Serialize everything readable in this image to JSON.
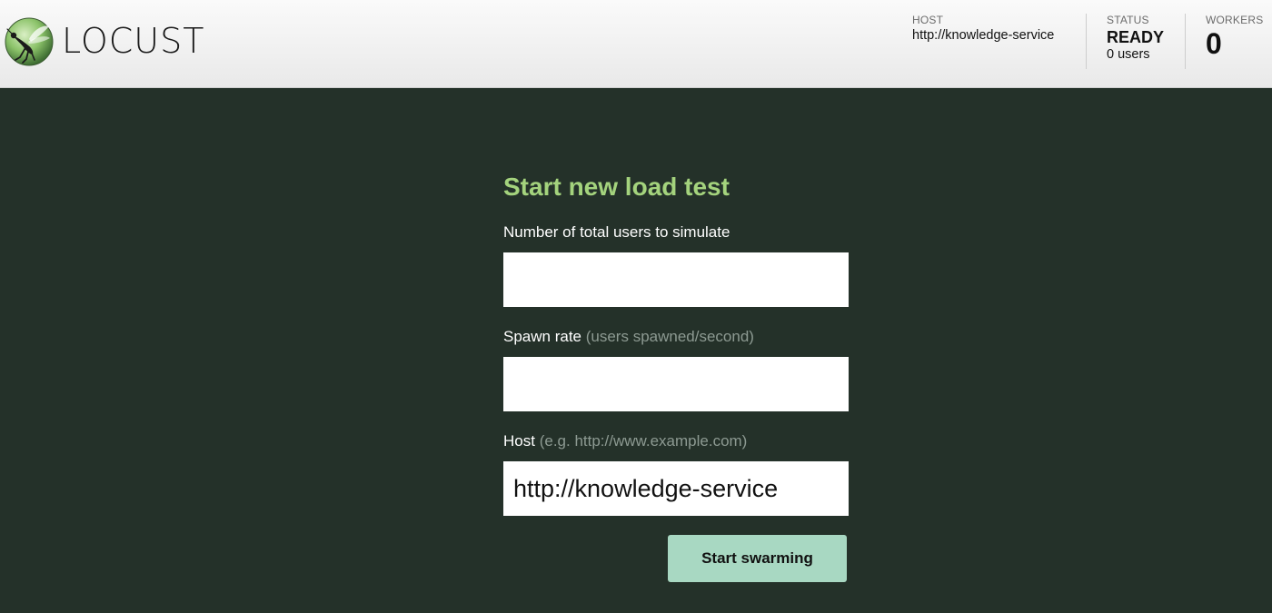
{
  "header": {
    "brand": "LOCUST",
    "logo_icon": "locust-logo-icon",
    "host": {
      "label": "HOST",
      "value": "http://knowledge-service"
    },
    "status": {
      "label": "STATUS",
      "value": "READY",
      "users": "0 users"
    },
    "workers": {
      "label": "WORKERS",
      "value": "0"
    }
  },
  "form": {
    "title": "Start new load test",
    "users": {
      "label": "Number of total users to simulate",
      "value": ""
    },
    "spawn_rate": {
      "label": "Spawn rate",
      "hint": "(users spawned/second)",
      "value": ""
    },
    "host": {
      "label": "Host",
      "hint": "(e.g. http://www.example.com)",
      "value": "http://knowledge-service"
    },
    "submit_label": "Start swarming"
  },
  "colors": {
    "background": "#243129",
    "title": "#a4d37d",
    "button": "#a8d8c2"
  }
}
